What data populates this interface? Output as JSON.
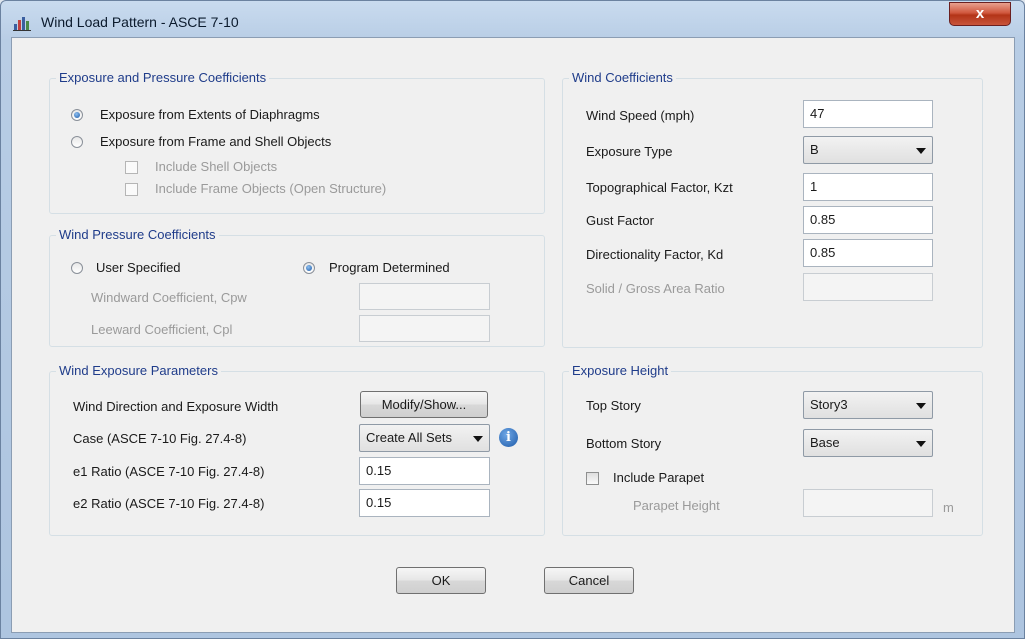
{
  "window": {
    "title": "Wind Load Pattern - ASCE 7-10",
    "close_glyph": "x"
  },
  "exposure_pressure": {
    "title": "Exposure and Pressure Coefficients",
    "opt_diaphragms": "Exposure from Extents of Diaphragms",
    "opt_frame_shell": "Exposure from Frame and Shell Objects",
    "chk_shell": "Include Shell Objects",
    "chk_frame": "Include Frame Objects (Open Structure)"
  },
  "wind_pressure": {
    "title": "Wind Pressure Coefficients",
    "opt_user": "User Specified",
    "opt_program": "Program Determined",
    "windward_label": "Windward Coefficient, Cpw",
    "leeward_label": "Leeward Coefficient, Cpl",
    "windward_value": "",
    "leeward_value": ""
  },
  "wind_exposure": {
    "title": "Wind Exposure Parameters",
    "direction_label": "Wind Direction and Exposure Width",
    "modify_button": "Modify/Show...",
    "case_label": "Case  (ASCE 7-10 Fig. 27.4-8)",
    "case_value": "Create All Sets",
    "e1_label": "e1 Ratio  (ASCE 7-10 Fig. 27.4-8)",
    "e1_value": "0.15",
    "e2_label": "e2 Ratio  (ASCE 7-10 Fig. 27.4-8)",
    "e2_value": "0.15"
  },
  "wind_coefficients": {
    "title": "Wind Coefficients",
    "speed_label": "Wind Speed (mph)",
    "speed_value": "47",
    "exposure_label": "Exposure Type",
    "exposure_value": "B",
    "kzt_label": "Topographical Factor, Kzt",
    "kzt_value": "1",
    "gust_label": "Gust Factor",
    "gust_value": "0.85",
    "kd_label": "Directionality Factor, Kd",
    "kd_value": "0.85",
    "solid_label": "Solid / Gross Area Ratio",
    "solid_value": ""
  },
  "exposure_height": {
    "title": "Exposure Height",
    "top_label": "Top Story",
    "top_value": "Story3",
    "bottom_label": "Bottom Story",
    "bottom_value": "Base",
    "parapet_check": "Include Parapet",
    "parapet_label": "Parapet Height",
    "parapet_value": "",
    "parapet_unit": "m"
  },
  "buttons": {
    "ok": "OK",
    "cancel": "Cancel"
  }
}
